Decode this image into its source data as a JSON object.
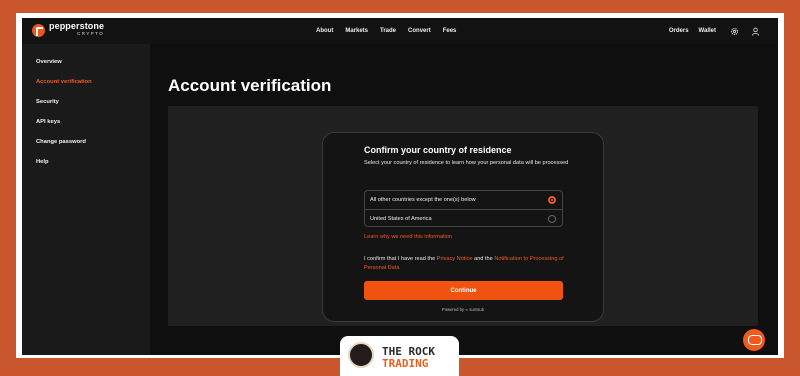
{
  "brand": {
    "name": "pepperstone",
    "sub": "CRYPTO"
  },
  "nav": [
    "About",
    "Markets",
    "Trade",
    "Convert",
    "Fees"
  ],
  "right_nav": {
    "orders": "Orders",
    "wallet": "Wallet",
    "icons": [
      "gear-icon",
      "user-icon"
    ]
  },
  "sidebar": {
    "items": [
      {
        "label": "Overview",
        "active": false
      },
      {
        "label": "Account verification",
        "active": true
      },
      {
        "label": "Security",
        "active": false
      },
      {
        "label": "API keys",
        "active": false
      },
      {
        "label": "Change password",
        "active": false
      },
      {
        "label": "Help",
        "active": false
      }
    ]
  },
  "page": {
    "title": "Account verification"
  },
  "card": {
    "title": "Confirm your country of residence",
    "description": "Select your country of residence to learn how your personal data will be processed",
    "options": [
      {
        "label": "All other countries except the one(s) below",
        "selected": true
      },
      {
        "label": "United States of America",
        "selected": false
      }
    ],
    "learn_link": "Learn why we need this information",
    "consent": {
      "prefix": "I confirm that I have read the",
      "privacy_link": "Privacy Notice",
      "middle": "and the",
      "processing_link": "Notification to Processing of Personal Data"
    },
    "button": "Continue",
    "powered": "Powered by",
    "powered_brand": "sumsub"
  },
  "watermark": {
    "line1": "THE ROCK",
    "line2": "TRADING"
  },
  "colors": {
    "accent": "#f05a1f",
    "background": "#0d0d0d",
    "frame": "#c9562c"
  }
}
